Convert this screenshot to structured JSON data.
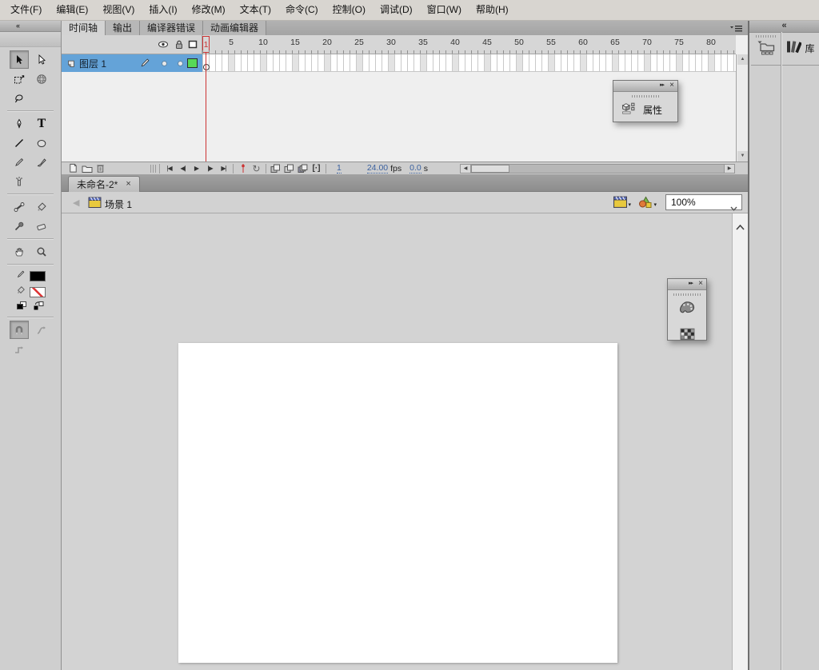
{
  "menu": {
    "items": [
      "文件(F)",
      "编辑(E)",
      "视图(V)",
      "插入(I)",
      "修改(M)",
      "文本(T)",
      "命令(C)",
      "控制(O)",
      "调试(D)",
      "窗口(W)",
      "帮助(H)"
    ]
  },
  "timeline": {
    "tabs": [
      "时间轴",
      "输出",
      "编译器错误",
      "动画编辑器"
    ],
    "ruler": {
      "current_frame": "1",
      "ticks": [
        "5",
        "10",
        "15",
        "20",
        "25",
        "30",
        "35",
        "40",
        "45",
        "50",
        "55",
        "60",
        "65",
        "70",
        "75",
        "80"
      ]
    },
    "layers": [
      {
        "name": "图层 1"
      }
    ],
    "controls": {
      "playback": [
        "|◀",
        "◀|",
        "▶",
        "|▶",
        "▶|"
      ],
      "onion_bracket": "[·]",
      "frame": "1",
      "fps": "24.00",
      "fps_unit": "fps",
      "elapsed": "0.0",
      "elapsed_unit": "s"
    }
  },
  "document": {
    "tab_title": "未命名-2*"
  },
  "edit_bar": {
    "scene_name": "场景 1",
    "zoom_value": "100%"
  },
  "right_dock": {
    "library_label": "库"
  },
  "floating_panels": {
    "properties": {
      "label": "属性"
    }
  },
  "icons": {
    "collapse": "«",
    "expand": "▸▸",
    "close": "×",
    "dropdown": "▾",
    "back": "◀",
    "up": "▲",
    "down": "▼",
    "left": "◀",
    "right": "▶",
    "loop": "↻",
    "text_tool": "T"
  },
  "colors": {
    "selection_blue": "#64a3d8",
    "keyframe_green": "#57d957",
    "playhead_red": "#cc3333",
    "stage": "#ffffff"
  }
}
